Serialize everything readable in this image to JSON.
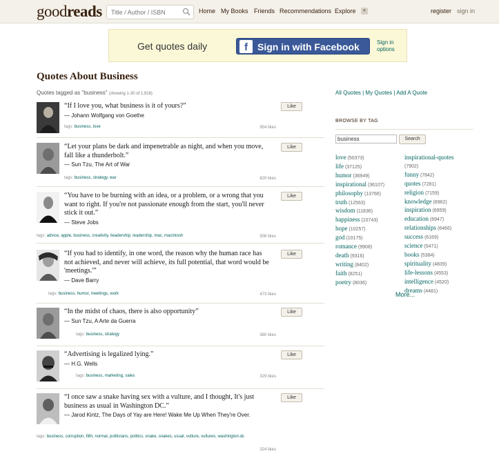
{
  "header": {
    "logo_light": "good",
    "logo_bold": "reads",
    "search_placeholder": "Title / Author / ISBN",
    "nav": [
      "Home",
      "My Books",
      "Friends",
      "Recommendations",
      "Explore"
    ],
    "register": "register",
    "sign_in": "sign in"
  },
  "banner": {
    "text": "Get quotes daily",
    "fb_icon": "f",
    "fb_button": "Sign in with Facebook",
    "sign_in_options": "Sign in options"
  },
  "main": {
    "title": "Quotes About Business",
    "showing": "Quotes tagged as \"business\"",
    "showing_count": "(showing 1-30 of 1,916)",
    "like_label": "Like",
    "tags_prefix": "tags:",
    "quotes": [
      {
        "text": "“If I love you, what business is it of yours?”",
        "author": "― Johann Wolfgang von Goethe",
        "tags": "business, love",
        "likes": "954 likes"
      },
      {
        "text": "“Let your plans be dark and impenetrable as night, and when you move, fall like a thunderbolt.”",
        "author": "― Sun Tzu, The Art of War",
        "tags": "business, strategy, war",
        "likes": "820 likes"
      },
      {
        "text": "“You have to be burning with an idea, or a problem, or a wrong that you want to right. If you're not passionate enough from the start, you'll never stick it out.”",
        "author": "― Steve Jobs",
        "tags": "advice, apple, business, creativity, ileadership, leadership, mac, macintosh",
        "likes": "508 likes"
      },
      {
        "text": "“If you had to identify, in one word, the reason why the human race has not achieved, and never will achieve, its full potential, that word would be 'meetings.'”",
        "author": "― Dave Barry",
        "tags": "business, humor, meetings, work",
        "likes": "473 likes"
      },
      {
        "text": "“In the midst of chaos, there is also opportunity”",
        "author": "― Sun Tzu, A Arte da Guerra",
        "tags": "business, strategy",
        "likes": "380 likes"
      },
      {
        "text": "“Advertising is legalized lying.”",
        "author": "― H.G. Wells",
        "tags": "business, marketing, sales",
        "likes": "329 likes"
      },
      {
        "text": "“I once saw a snake having sex with a vulture, and I thought, It's just business as usual in Washington DC.”",
        "author": "― Jarod Kintz, The Days of Yay are Here! Wake Me Up When They're Over.",
        "tags": "business, corruption, filth, normal, politicians, politics, snake, snakes, usual, vulture, vultures, washington-dc",
        "likes": "324 likes"
      }
    ]
  },
  "sidebar": {
    "links": "All Quotes | My Quotes | Add A Quote",
    "browse_title": "BROWSE BY TAG",
    "tag_input_value": "business",
    "search_button": "Search",
    "tags_col1": [
      {
        "name": "love",
        "count": "(50373)"
      },
      {
        "name": "life",
        "count": "(37125)"
      },
      {
        "name": "humor",
        "count": "(36949)"
      },
      {
        "name": "inspirational",
        "count": "(36107)"
      },
      {
        "name": "philosophy",
        "count": "(13766)"
      },
      {
        "name": "truth",
        "count": "(12563)"
      },
      {
        "name": "wisdom",
        "count": "(11836)"
      },
      {
        "name": "happiness",
        "count": "(10743)"
      },
      {
        "name": "hope",
        "count": "(10257)"
      },
      {
        "name": "god",
        "count": "(10175)"
      },
      {
        "name": "romance",
        "count": "(9908)"
      },
      {
        "name": "death",
        "count": "(9316)"
      },
      {
        "name": "writing",
        "count": "(8402)"
      },
      {
        "name": "faith",
        "count": "(8251)"
      },
      {
        "name": "poetry",
        "count": "(8036)"
      }
    ],
    "tags_col2": [
      {
        "name": "inspirational-quotes",
        "count": "(7902)"
      },
      {
        "name": "funny",
        "count": "(7842)"
      },
      {
        "name": "quotes",
        "count": "(7281)"
      },
      {
        "name": "religion",
        "count": "(7159)"
      },
      {
        "name": "knowledge",
        "count": "(6962)"
      },
      {
        "name": "inspiration",
        "count": "(6959)"
      },
      {
        "name": "education",
        "count": "(6947)"
      },
      {
        "name": "relationships",
        "count": "(6466)"
      },
      {
        "name": "success",
        "count": "(6169)"
      },
      {
        "name": "science",
        "count": "(5471)"
      },
      {
        "name": "books",
        "count": "(5384)"
      },
      {
        "name": "spirituality",
        "count": "(4839)"
      },
      {
        "name": "life-lessons",
        "count": "(4553)"
      },
      {
        "name": "intelligence",
        "count": "(4520)"
      },
      {
        "name": "dreams",
        "count": "(4481)"
      }
    ],
    "more": "More..."
  }
}
